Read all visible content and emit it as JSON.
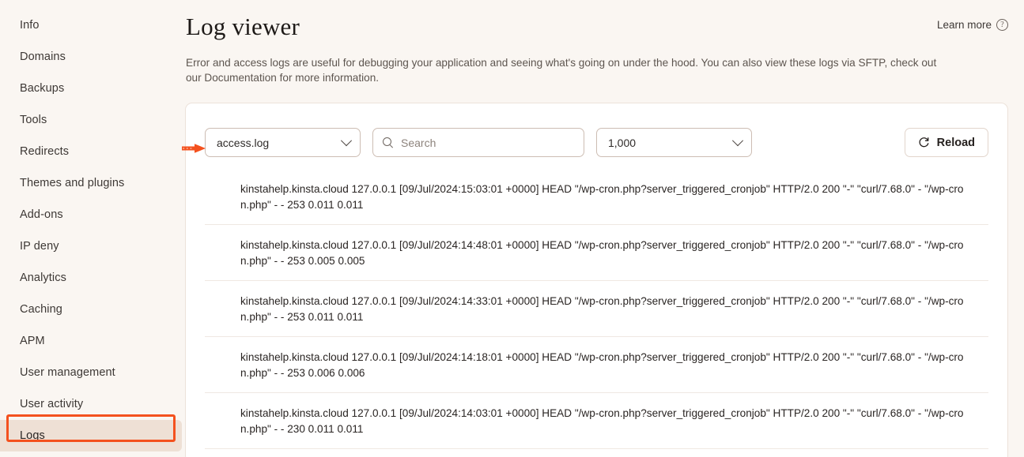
{
  "sidebar": {
    "items": [
      {
        "label": "Info",
        "active": false
      },
      {
        "label": "Domains",
        "active": false
      },
      {
        "label": "Backups",
        "active": false
      },
      {
        "label": "Tools",
        "active": false
      },
      {
        "label": "Redirects",
        "active": false
      },
      {
        "label": "Themes and plugins",
        "active": false
      },
      {
        "label": "Add-ons",
        "active": false
      },
      {
        "label": "IP deny",
        "active": false
      },
      {
        "label": "Analytics",
        "active": false
      },
      {
        "label": "Caching",
        "active": false
      },
      {
        "label": "APM",
        "active": false
      },
      {
        "label": "User management",
        "active": false
      },
      {
        "label": "User activity",
        "active": false
      },
      {
        "label": "Logs",
        "active": true
      }
    ]
  },
  "header": {
    "title": "Log viewer",
    "learn_more_label": "Learn more",
    "learn_more_icon": "question-circle-icon",
    "description": "Error and access logs are useful for debugging your application and seeing what's going on under the hood. You can also view these logs via SFTP, check out our Documentation for more information."
  },
  "toolbar": {
    "log_file_selected": "access.log",
    "log_file_icon": "chevron-down-icon",
    "search_placeholder": "Search",
    "search_value": "",
    "search_icon": "search-icon",
    "line_count_selected": "1,000",
    "line_count_icon": "chevron-down-icon",
    "reload_label": "Reload",
    "reload_icon": "refresh-icon"
  },
  "log_entries": [
    {
      "line": "kinstahelp.kinsta.cloud 127.0.0.1 [09/Jul/2024:15:03:01 +0000] HEAD \"/wp-cron.php?server_triggered_cronjob\" HTTP/2.0 200 \"-\" \"curl/7.68.0\" - \"/wp-cron.php\" - - 253 0.011 0.011"
    },
    {
      "line": "kinstahelp.kinsta.cloud 127.0.0.1 [09/Jul/2024:14:48:01 +0000] HEAD \"/wp-cron.php?server_triggered_cronjob\" HTTP/2.0 200 \"-\" \"curl/7.68.0\" - \"/wp-cron.php\" - - 253 0.005 0.005"
    },
    {
      "line": "kinstahelp.kinsta.cloud 127.0.0.1 [09/Jul/2024:14:33:01 +0000] HEAD \"/wp-cron.php?server_triggered_cronjob\" HTTP/2.0 200 \"-\" \"curl/7.68.0\" - \"/wp-cron.php\" - - 253 0.011 0.011"
    },
    {
      "line": "kinstahelp.kinsta.cloud 127.0.0.1 [09/Jul/2024:14:18:01 +0000] HEAD \"/wp-cron.php?server_triggered_cronjob\" HTTP/2.0 200 \"-\" \"curl/7.68.0\" - \"/wp-cron.php\" - - 253 0.006 0.006"
    },
    {
      "line": "kinstahelp.kinsta.cloud 127.0.0.1 [09/Jul/2024:14:03:01 +0000] HEAD \"/wp-cron.php?server_triggered_cronjob\" HTTP/2.0 200 \"-\" \"curl/7.68.0\" - \"/wp-cron.php\" - - 230 0.011 0.011"
    }
  ],
  "annotations": {
    "arrow_color": "#f4511e",
    "highlight_color": "#f4511e",
    "arrow_target": "log-file-select",
    "highlight_target": "sidebar-item-logs"
  },
  "colors": {
    "page_background": "#faf6f2",
    "card_background": "#ffffff",
    "active_nav_background": "#eee0d5",
    "accent": "#f4511e",
    "border": "#cdbdb3"
  }
}
